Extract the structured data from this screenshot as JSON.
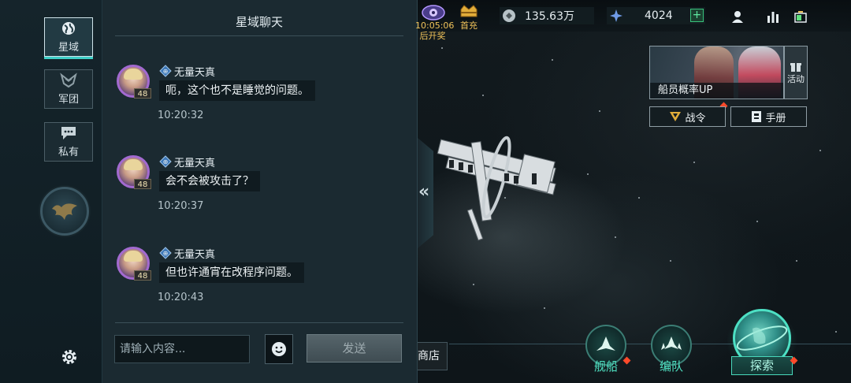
{
  "rail": {
    "tabs": [
      {
        "label": "星域",
        "icon": "globe-icon",
        "active": true
      },
      {
        "label": "军团",
        "icon": "legion-icon",
        "active": false
      },
      {
        "label": "私有",
        "icon": "chat-bubble-icon",
        "active": false
      }
    ],
    "emblem_icon": "phoenix-emblem-icon",
    "settings_icon": "gear-icon"
  },
  "chat": {
    "title": "星域聊天",
    "messages": [
      {
        "sender": "无量天真",
        "level": "48",
        "text": "呃，这个也不是睡觉的问题。",
        "time": "10:20:32"
      },
      {
        "sender": "无量天真",
        "level": "48",
        "text": "会不会被攻击了？",
        "time": "10:20:37"
      },
      {
        "sender": "无量天真",
        "level": "48",
        "text": "但也许通宵在改程序问题。",
        "time": "10:20:43"
      }
    ],
    "input_placeholder": "请输入内容...",
    "send_label": "发送"
  },
  "hud": {
    "event_timer": "10:05:06",
    "event_label": "后开奖",
    "first_recharge_label": "首充",
    "credits": "135.63万",
    "crystal": "4024",
    "plus_label": "+"
  },
  "cards": {
    "recruit_label": "船员概率UP",
    "activity_label": "活动",
    "battlepass_label": "战令",
    "manual_label": "手册"
  },
  "bottom_nav": {
    "shop_label": "商店",
    "ships_label": "舰船",
    "fleet_label": "编队",
    "explore_label": "探索"
  },
  "colors": {
    "accent": "#3fd0c8",
    "gold": "#f0c35a",
    "alert": "#ff4a2a"
  }
}
